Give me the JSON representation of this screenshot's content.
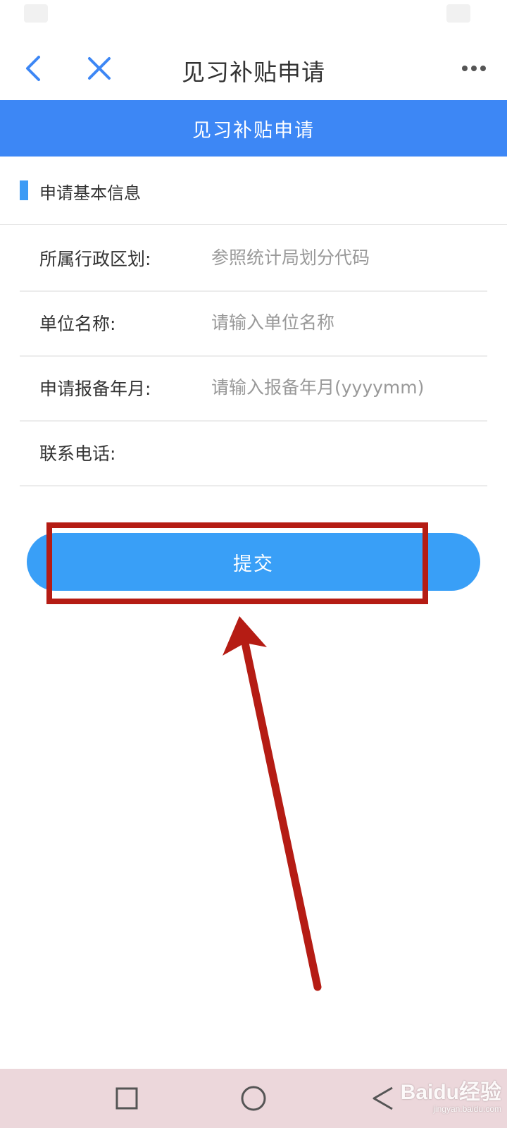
{
  "nav_header": {
    "title": "见习补贴申请",
    "back_icon": "chevron-left-icon",
    "close_icon": "close-icon",
    "more_icon": "more-icon"
  },
  "banner": {
    "title": "见习补贴申请"
  },
  "section": {
    "title": "申请基本信息"
  },
  "form": {
    "fields": [
      {
        "label": "所属行政区划:",
        "value": "",
        "placeholder": "参照统计局划分代码"
      },
      {
        "label": "单位名称:",
        "value": "",
        "placeholder": "请输入单位名称"
      },
      {
        "label": "申请报备年月:",
        "value": "",
        "placeholder": "请输入报备年月(yyyymm)"
      },
      {
        "label": "联系电话:",
        "value": "",
        "placeholder": ""
      }
    ]
  },
  "submit": {
    "label": "提交"
  },
  "system_nav": {
    "recent_icon": "square-icon",
    "home_icon": "circle-icon",
    "back_icon": "triangle-back-icon"
  },
  "watermark": {
    "brand": "Baidu经验",
    "url": "jingyan.baidu.com"
  },
  "colors": {
    "primary_blue": "#3d87f5",
    "button_blue": "#399ff7",
    "annotation_red": "#b51c14",
    "system_nav_bg": "#ecd7db"
  }
}
